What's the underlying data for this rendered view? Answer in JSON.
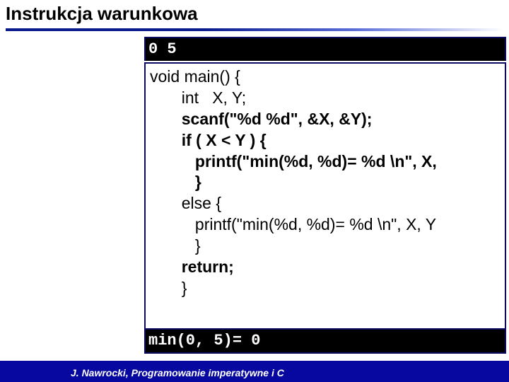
{
  "title": "Instrukcja warunkowa",
  "top_bar": "0  5",
  "code": {
    "l1": "void main() {",
    "l2": "       int   X, Y;",
    "l3a": "       ",
    "l3b": "scanf(\"%d %d\", &X, &Y);",
    "l4a": "       ",
    "l4b": "if ( X < Y ) {",
    "l5a": "          ",
    "l5b": "printf(\"min(%d, %d)= %d \\n\", X,",
    "l6a": "          ",
    "l6b": "}",
    "l7": "       else {",
    "l8": "          printf(\"min(%d, %d)= %d \\n\", X, Y",
    "l9": "          }",
    "l10a": "       ",
    "l10b": "return;",
    "l11": "       }"
  },
  "bottom_bar": "min(0, 5)= 0",
  "footer": "J. Nawrocki, Programowanie imperatywne i C"
}
